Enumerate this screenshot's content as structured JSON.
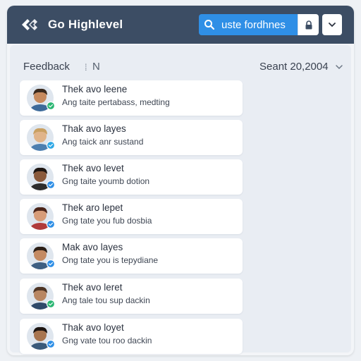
{
  "header": {
    "brand": "Go Highlevel",
    "logo_icon": "go-highlevel-logo-icon",
    "search_value": "uste fordhnes",
    "search_icon": "search-icon",
    "lock_icon": "lock-icon",
    "menu_icon": "chevron-down-icon",
    "bar_color": "#3c4d64",
    "accent_color": "#2f8fe6"
  },
  "panel": {
    "feedback_label": "Feedback",
    "separator": "⁞",
    "filter_letter": "N",
    "date_value": "Seant 20,2004",
    "date_icon": "chevron-down-icon"
  },
  "items": [
    {
      "title": "Thek avo leene",
      "subtitle": "Ang taite pertabass, medting",
      "status": "online",
      "status_color": "#2bb673"
    },
    {
      "title": "Thak avo layes",
      "subtitle": "Ang taick anr sustand",
      "status": "away",
      "status_color": "#2fa8e6"
    },
    {
      "title": "Thek avo levet",
      "subtitle": "Gng taite youmb dotion",
      "status": "away",
      "status_color": "#2f8fe6"
    },
    {
      "title": "Thek aro lepet",
      "subtitle": "Gng tate you fub dosbia",
      "status": "away",
      "status_color": "#2f8fe6"
    },
    {
      "title": "Mak avo layes",
      "subtitle": "Ong tate you is tepydiane",
      "status": "away",
      "status_color": "#2f8fe6"
    },
    {
      "title": "Thek avo leret",
      "subtitle": "Ang tale tou sup dackin",
      "status": "online",
      "status_color": "#2bb673"
    },
    {
      "title": "Thak avo loyet",
      "subtitle": "Gng vate tou roo dackin",
      "status": "away",
      "status_color": "#2f8fe6"
    }
  ]
}
